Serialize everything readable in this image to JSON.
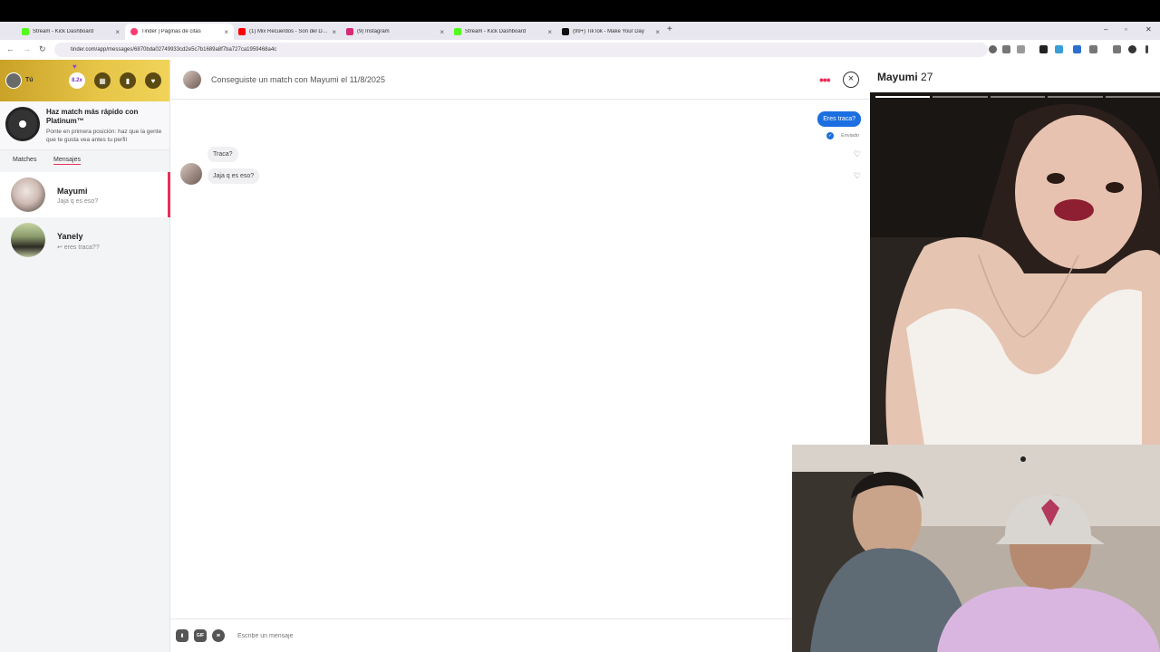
{
  "browser": {
    "tabs": [
      {
        "title": "Stream - Kick Dashboard",
        "color": "#53fc18"
      },
      {
        "title": "Tinder | Páginas de citas",
        "color": "#fe3c72",
        "active": true
      },
      {
        "title": "(1) Mix Recuerdos - Son del D…",
        "color": "#ff0000"
      },
      {
        "title": "(9) Instagram",
        "color": "#d62976"
      },
      {
        "title": "Stream - Kick Dashboard",
        "color": "#53fc18"
      },
      {
        "title": "(99+) TikTok - Make Your Day",
        "color": "#111111"
      }
    ],
    "url": "tinder.com/app/messages/6870bda02749933cd2e5c7b1689a8f7ba727ca1959468a4c"
  },
  "sidebar": {
    "user_label": "Tú",
    "boost_value": "8.2x",
    "promo_title": "Haz match más rápido con Platinum™",
    "promo_subtitle": "Ponte en primera posición: haz que la gente que te gusta vea antes tu perfil",
    "tabs": [
      "Matches",
      "Mensajes"
    ],
    "conversations": [
      {
        "name": "Mayumi",
        "last": "Jaja q es eso?"
      },
      {
        "name": "Yanely",
        "last": "↩ eres traca??"
      }
    ]
  },
  "chat": {
    "header": "Conseguiste un match con Mayumi el 11/8/2025",
    "messages": [
      {
        "from": "me",
        "text": "Eres traca?"
      },
      {
        "from": "them",
        "text": "Traca?"
      },
      {
        "from": "them",
        "text": "Jaja q es eso?"
      }
    ],
    "sent_status": "Enviado",
    "composer": {
      "placeholder": "Escribe un mensaje",
      "gif_label": "GIF"
    }
  },
  "profile": {
    "name": "Mayumi",
    "age": "27",
    "photo_count": 5,
    "current_photo": 1
  },
  "colors": {
    "accent": "#e8305a",
    "bubble_out": "#1b6fe0",
    "gold": "#e7c648"
  }
}
